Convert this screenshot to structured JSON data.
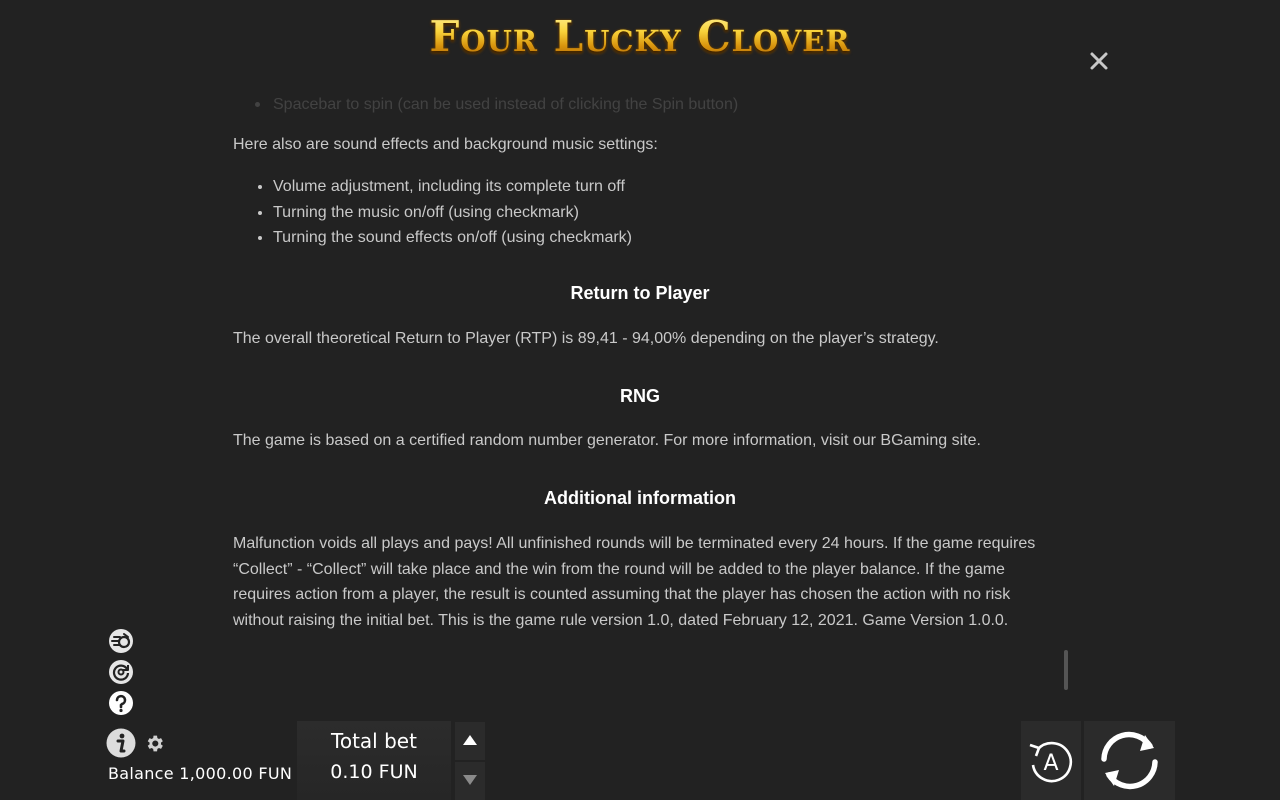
{
  "header": {
    "logo_text": "Four Lucky Clover"
  },
  "content": {
    "faded_item": "Spacebar to spin (can be used instead of clicking the Spin button)",
    "sound_intro": "Here also are sound effects and background music settings:",
    "sound_items": [
      "Volume adjustment, including its complete turn off",
      "Turning the music on/off (using checkmark)",
      "Turning the sound effects on/off (using checkmark)"
    ],
    "rtp_heading": "Return to Player",
    "rtp_text": "The overall theoretical Return to Player (RTP) is 89,41 - 94,00% depending on the player’s strategy.",
    "rng_heading": "RNG",
    "rng_text": "The game is based on a certified random number generator. For more information, visit our BGaming site.",
    "additional_heading": "Additional information",
    "additional_text": "Malfunction voids all plays and pays! All unfinished rounds will be terminated every 24 hours. If the game requires “Collect” - “Collect” will take place and the win from the round will be added to the player balance. If the game requires action from a player, the result is counted assuming that the player has chosen the action with no risk without raising the initial bet. This is the game rule version 1.0, dated February 12, 2021. Game Version 1.0.0."
  },
  "footer": {
    "balance_label": "Balance 1,000.00 FUN",
    "bet_label": "Total bet",
    "bet_value": "0.10 FUN",
    "auto_label": "A"
  }
}
